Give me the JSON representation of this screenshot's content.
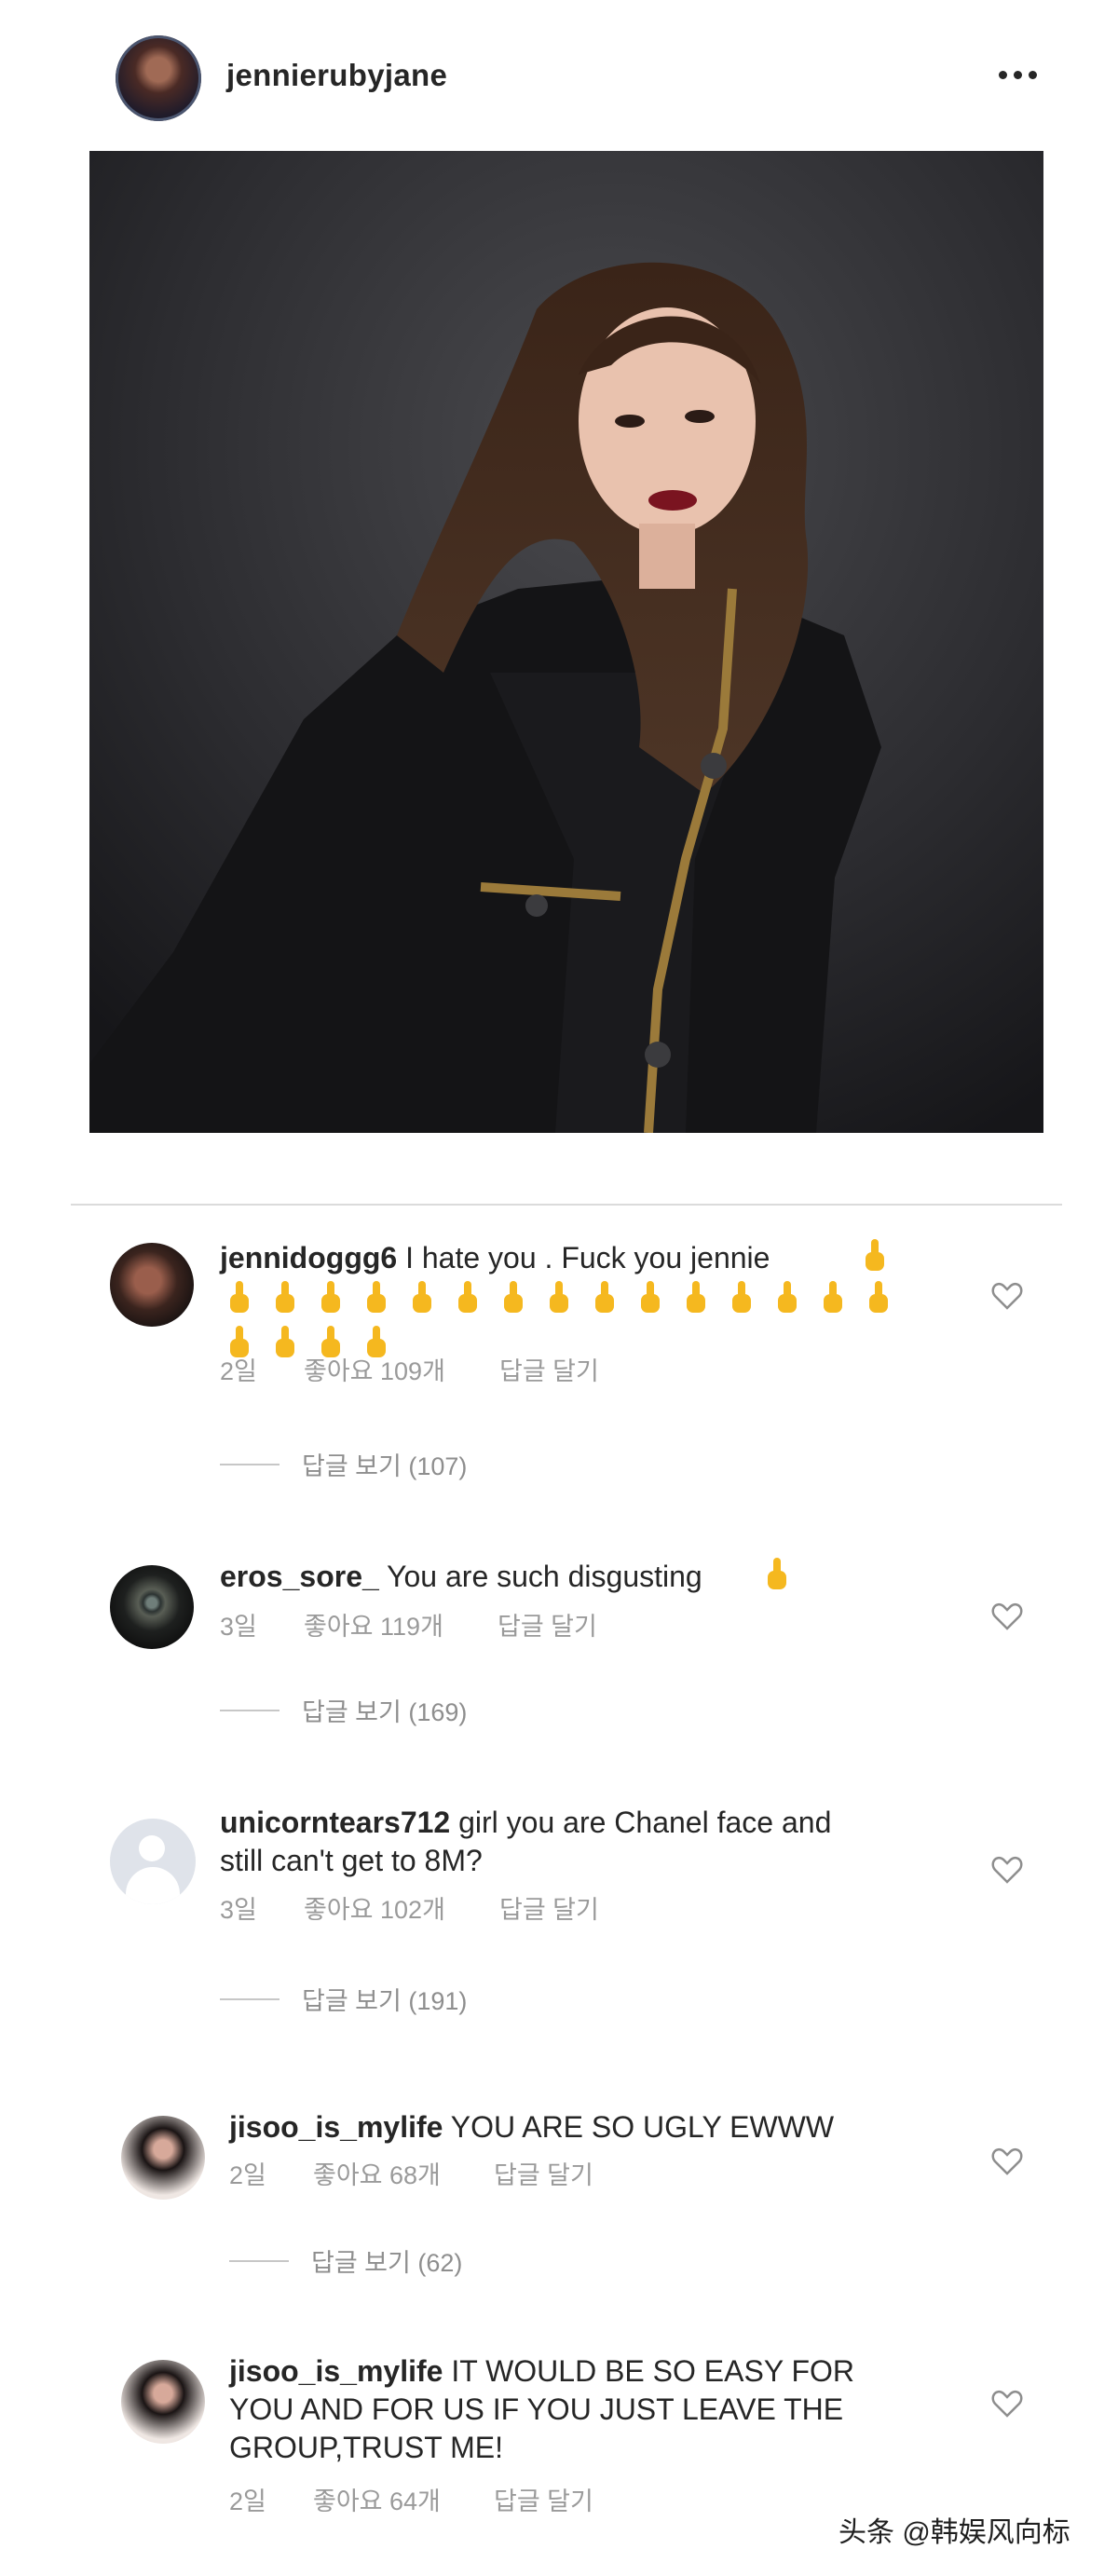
{
  "post": {
    "username": "jennierubyjane"
  },
  "comments": [
    {
      "username": "jennidoggg6",
      "text": "I hate you . Fuck you  jennie",
      "time": "2일",
      "likes": "좋아요 109개",
      "reply": "답글 달기",
      "view_replies": "답글 보기 (107)",
      "emoji_count": 20
    },
    {
      "username": "eros_sore_",
      "text": "You are such disgusting",
      "time": "3일",
      "likes": "좋아요 119개",
      "reply": "답글 달기",
      "view_replies": "답글 보기 (169)",
      "emoji_count": 1
    },
    {
      "username": "unicorntears712",
      "text": "girl you are Chanel face and",
      "text2": "still can't get to 8M?",
      "time": "3일",
      "likes": "좋아요 102개",
      "reply": "답글 달기",
      "view_replies": "답글 보기 (191)"
    },
    {
      "username": "jisoo_is_mylife",
      "text": "YOU ARE SO UGLY EWWW",
      "time": "2일",
      "likes": "좋아요 68개",
      "reply": "답글 달기",
      "view_replies": "답글 보기 (62)"
    },
    {
      "username": "jisoo_is_mylife",
      "text": "IT WOULD BE SO EASY FOR",
      "text2": "YOU AND FOR US IF YOU JUST LEAVE THE",
      "text3": "GROUP,TRUST ME!",
      "time": "2일",
      "likes": "좋아요 64개",
      "reply": "답글 달기"
    }
  ],
  "watermark": "头条 @韩娱风向标",
  "icons": {
    "more": "more-icon",
    "heart": "heart-icon",
    "emoji": "middle-finger-emoji"
  },
  "colors": {
    "text": "#262626",
    "meta": "#9a9a9a",
    "emoji": "#f5b81f"
  }
}
